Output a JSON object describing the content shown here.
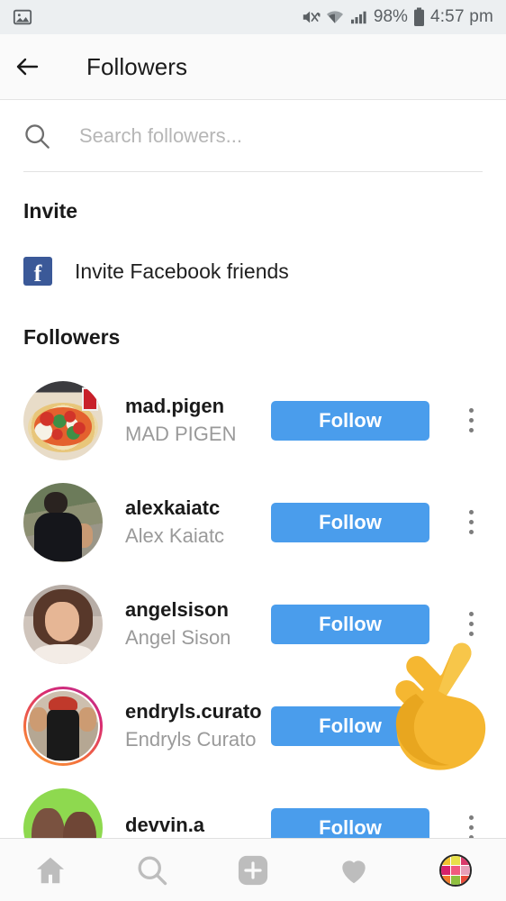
{
  "status_bar": {
    "left_icons": [
      "image-icon"
    ],
    "mute_icon": "mute-vibrate-icon",
    "wifi_icon": "wifi-icon",
    "signal_icon": "cellular-signal-icon",
    "battery_percent": "98%",
    "battery_icon": "battery-icon",
    "time": "4:57 pm",
    "bg_color": "#eceff1",
    "text_color": "#5b6064"
  },
  "app_bar": {
    "back_icon": "back-arrow-icon",
    "title": "Followers",
    "bg_color": "#fafafa"
  },
  "search": {
    "icon": "search-icon",
    "value": "",
    "placeholder": "Search followers..."
  },
  "invite": {
    "section_title": "Invite",
    "facebook_icon_letter": "f",
    "facebook_icon_color": "#3b5998",
    "facebook_label": "Invite Facebook friends"
  },
  "followers": {
    "section_title": "Followers",
    "follow_label": "Follow",
    "follow_color": "#4a9dec",
    "overflow_icon": "overflow-menu-icon",
    "items": [
      {
        "username": "mad.pigen",
        "fullname": "MAD PIGEN",
        "avatar": "pizza-photo",
        "has_story_ring": false,
        "button": "Follow"
      },
      {
        "username": "alexkaiatc",
        "fullname": "Alex Kaiatc",
        "avatar": "man-sunglasses-photo",
        "has_story_ring": false,
        "button": "Follow"
      },
      {
        "username": "angelsison",
        "fullname": "Angel Sison",
        "avatar": "woman-smiling-photo",
        "has_story_ring": false,
        "button": "Follow"
      },
      {
        "username": "endryls.curato",
        "fullname": "Endryls Curato",
        "avatar": "gym-flexing-photo",
        "has_story_ring": true,
        "button": "Follow"
      },
      {
        "username": "devvin.a",
        "fullname": "",
        "avatar": "two-people-green-photo",
        "has_story_ring": false,
        "button": "Follow"
      }
    ]
  },
  "overlay": {
    "pointer_icon": "pointing-hand-emoji",
    "pointer_glyph": "☝"
  },
  "bottom_nav": {
    "items": [
      {
        "name": "home",
        "icon": "home-icon"
      },
      {
        "name": "search",
        "icon": "search-icon"
      },
      {
        "name": "add",
        "icon": "add-plus-icon"
      },
      {
        "name": "activity",
        "icon": "heart-icon"
      },
      {
        "name": "profile",
        "icon": "profile-avatar-icon"
      }
    ],
    "profile_avatar_colors": [
      "#f2c230",
      "#e8e04a",
      "#d93a6a",
      "#d6216b",
      "#f05a7e",
      "#e8a0b8",
      "#f07a2a",
      "#8fbf3f",
      "#e84a3a"
    ]
  }
}
